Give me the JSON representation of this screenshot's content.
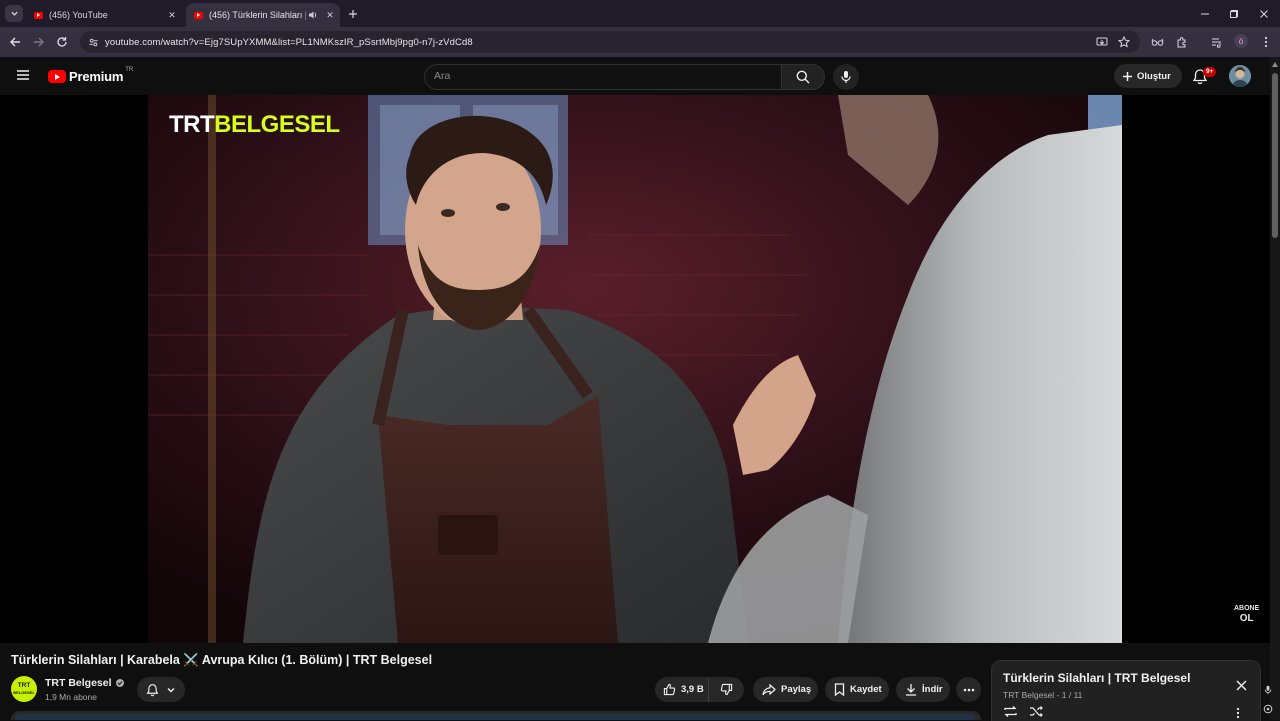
{
  "browser": {
    "tabs": [
      {
        "title": "(456) YouTube",
        "active": false
      },
      {
        "title": "(456) Türklerin Silahları | Ka",
        "active": true
      }
    ],
    "url": "youtube.com/watch?v=Ejg7SUpYXMM&list=PL1NMKszIR_pSsrtMbj9pg0-n7j-zVdCd8",
    "profile_initial": "ö"
  },
  "masthead": {
    "logo_text": "Premium",
    "country_code": "TR",
    "search_placeholder": "Ara",
    "create_label": "Oluştur",
    "notification_badge": "9+"
  },
  "video": {
    "watermark_part1": "TRT",
    "watermark_part2": "BELGESEL",
    "subscribe_overlay_line1": "ABONE",
    "subscribe_overlay_line2": "OL",
    "title": "Türklerin Silahları | Karabela ⚔️ Avrupa Kılıcı (1. Bölüm) | TRT Belgesel"
  },
  "channel": {
    "avatar_line1": "TRT",
    "avatar_line2": "BELGESEL",
    "name": "TRT Belgesel",
    "subscribers": "1,9 Mn abone"
  },
  "actions": {
    "like_count": "3,9 B",
    "share_label": "Paylaş",
    "save_label": "Kaydet",
    "download_label": "İndir"
  },
  "playlist": {
    "title": "Türklerin Silahları | TRT Belgesel",
    "channel": "TRT Belgesel",
    "position": "- 1 / 11"
  },
  "colors": {
    "yt_red": "#ff0000",
    "trt_yellow": "#d6ff1a",
    "background": "#0f0f0f"
  }
}
